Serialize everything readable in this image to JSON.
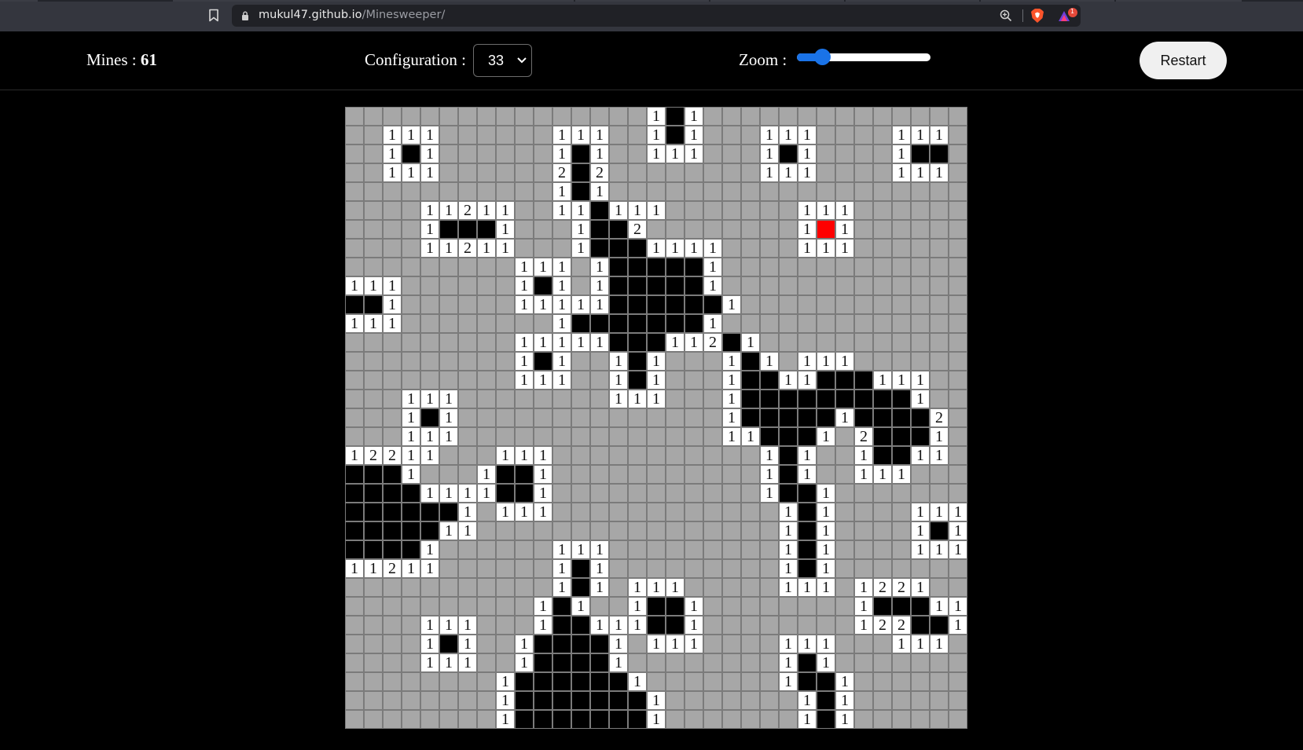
{
  "browser": {
    "url_host": "mukul47.github.io",
    "url_path": "/Minesweeper/",
    "icons": [
      "bookmark-icon",
      "lock-icon",
      "zoom-icon",
      "brave-shield-icon",
      "brave-rewards-icon"
    ],
    "rewards_badge": "1"
  },
  "header": {
    "mines_label": "Mines :",
    "mines_count": "61",
    "config_label": "Configuration :",
    "config_value": "33",
    "zoom_label": "Zoom :",
    "zoom_level": 0.15,
    "restart_label": "Restart"
  },
  "colors": {
    "hidden_cell": "#a7a7a7",
    "open_cell": "#ffffff",
    "revealed_empty": "#000000",
    "exploded_mine": "#ff0000",
    "zoom_accent": "#1a73e8"
  },
  "board": {
    "size": 33,
    "legend": {
      "#": "hidden",
      "O": "revealed-empty",
      "X": "exploded-mine",
      "1": "number 1",
      "2": "number 2"
    },
    "rows": [
      "################1O1################",
      "##111######111##1O1###111####111###",
      "##1O1######1O1##111###1O1####1OO###",
      "##111######2O2########111####111###",
      "###########1O1#####################",
      "####11211##11O111#######111########",
      "####1OOO1###1OO2########1X1########",
      "####11211###1OOO1111####111########",
      "#########111#1OOOOO1###############",
      "111######1O1#1OOOOO1###############",
      "OO1######11111OOOOOO1###############",
      "111########1OOOOOOO1###############",
      "#########11111OOO112O1#############",
      "#########1O1##1O1###1O1#111########",
      "#########111##1O1###1OO11OOO111####",
      "###111########111###1OOOOOOOOO1####",
      "###1O1##############1OOOOO1OOOO2###",
      "###111##############11OOO1#2OOO1###",
      "12211###111###########1O1##1OO11###",
      "OOO1###1OO1###########1O1##111#####",
      "OOOO1111OO1###########1OO1#########",
      "OOOOOO1#111############1O1####111##",
      "OOOOO11################1O1####1O1##",
      "OOOO1######111#########1O1####111##",
      "11211######1O1#########1O1#########",
      "###########1O1#111#####111#1221####",
      "##########1O1##1OO1########1OOO11##",
      "####111###1OO111OO1########122OO1##",
      "####1O1##1OOOO1#111####111###111###",
      "####111##1OOOO1########1O1#########",
      "########1OOOOOO1#######1OO1########",
      "########1OOOOOOO1#######1O1########",
      "########1OOOOOOO1#######1O1########"
    ]
  }
}
